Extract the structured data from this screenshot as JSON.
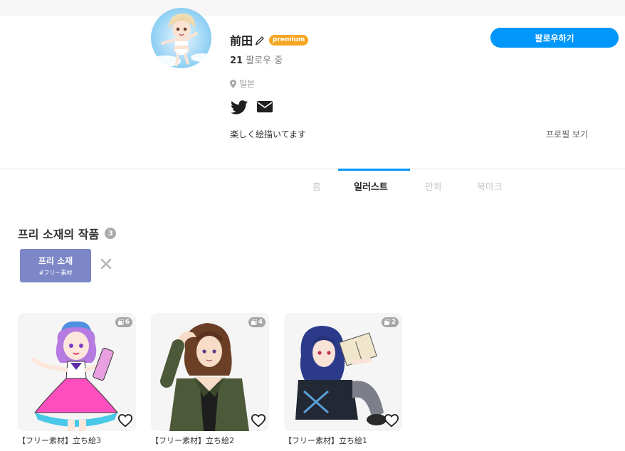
{
  "profile": {
    "name": "前田",
    "premium_label": "premium",
    "following_count": "21",
    "following_label": "팔로우 중",
    "location": "일본",
    "bio": "楽しく絵描いてます",
    "profile_link": "프로필 보기",
    "follow_button": "팔로우하기",
    "social_icons": [
      "twitter-icon",
      "mail-icon"
    ]
  },
  "tabs": [
    {
      "label": "홈",
      "active": false
    },
    {
      "label": "일러스트",
      "active": true
    },
    {
      "label": "만화",
      "active": false
    },
    {
      "label": "북마크",
      "active": false
    }
  ],
  "section": {
    "title": "프리 소재의 작품",
    "count": "3"
  },
  "tag_filter": {
    "label": "프리 소재",
    "sub": "#フリー素材"
  },
  "works": [
    {
      "title": "【フリー素材】立ち絵3",
      "pages": "6"
    },
    {
      "title": "【フリー素材】立ち絵2",
      "pages": "4"
    },
    {
      "title": "【フリー素材】立ち絵1",
      "pages": "2"
    }
  ],
  "colors": {
    "accent": "#0096fa",
    "premium": "#f4a623",
    "tag_chip": "#7d87c7"
  }
}
